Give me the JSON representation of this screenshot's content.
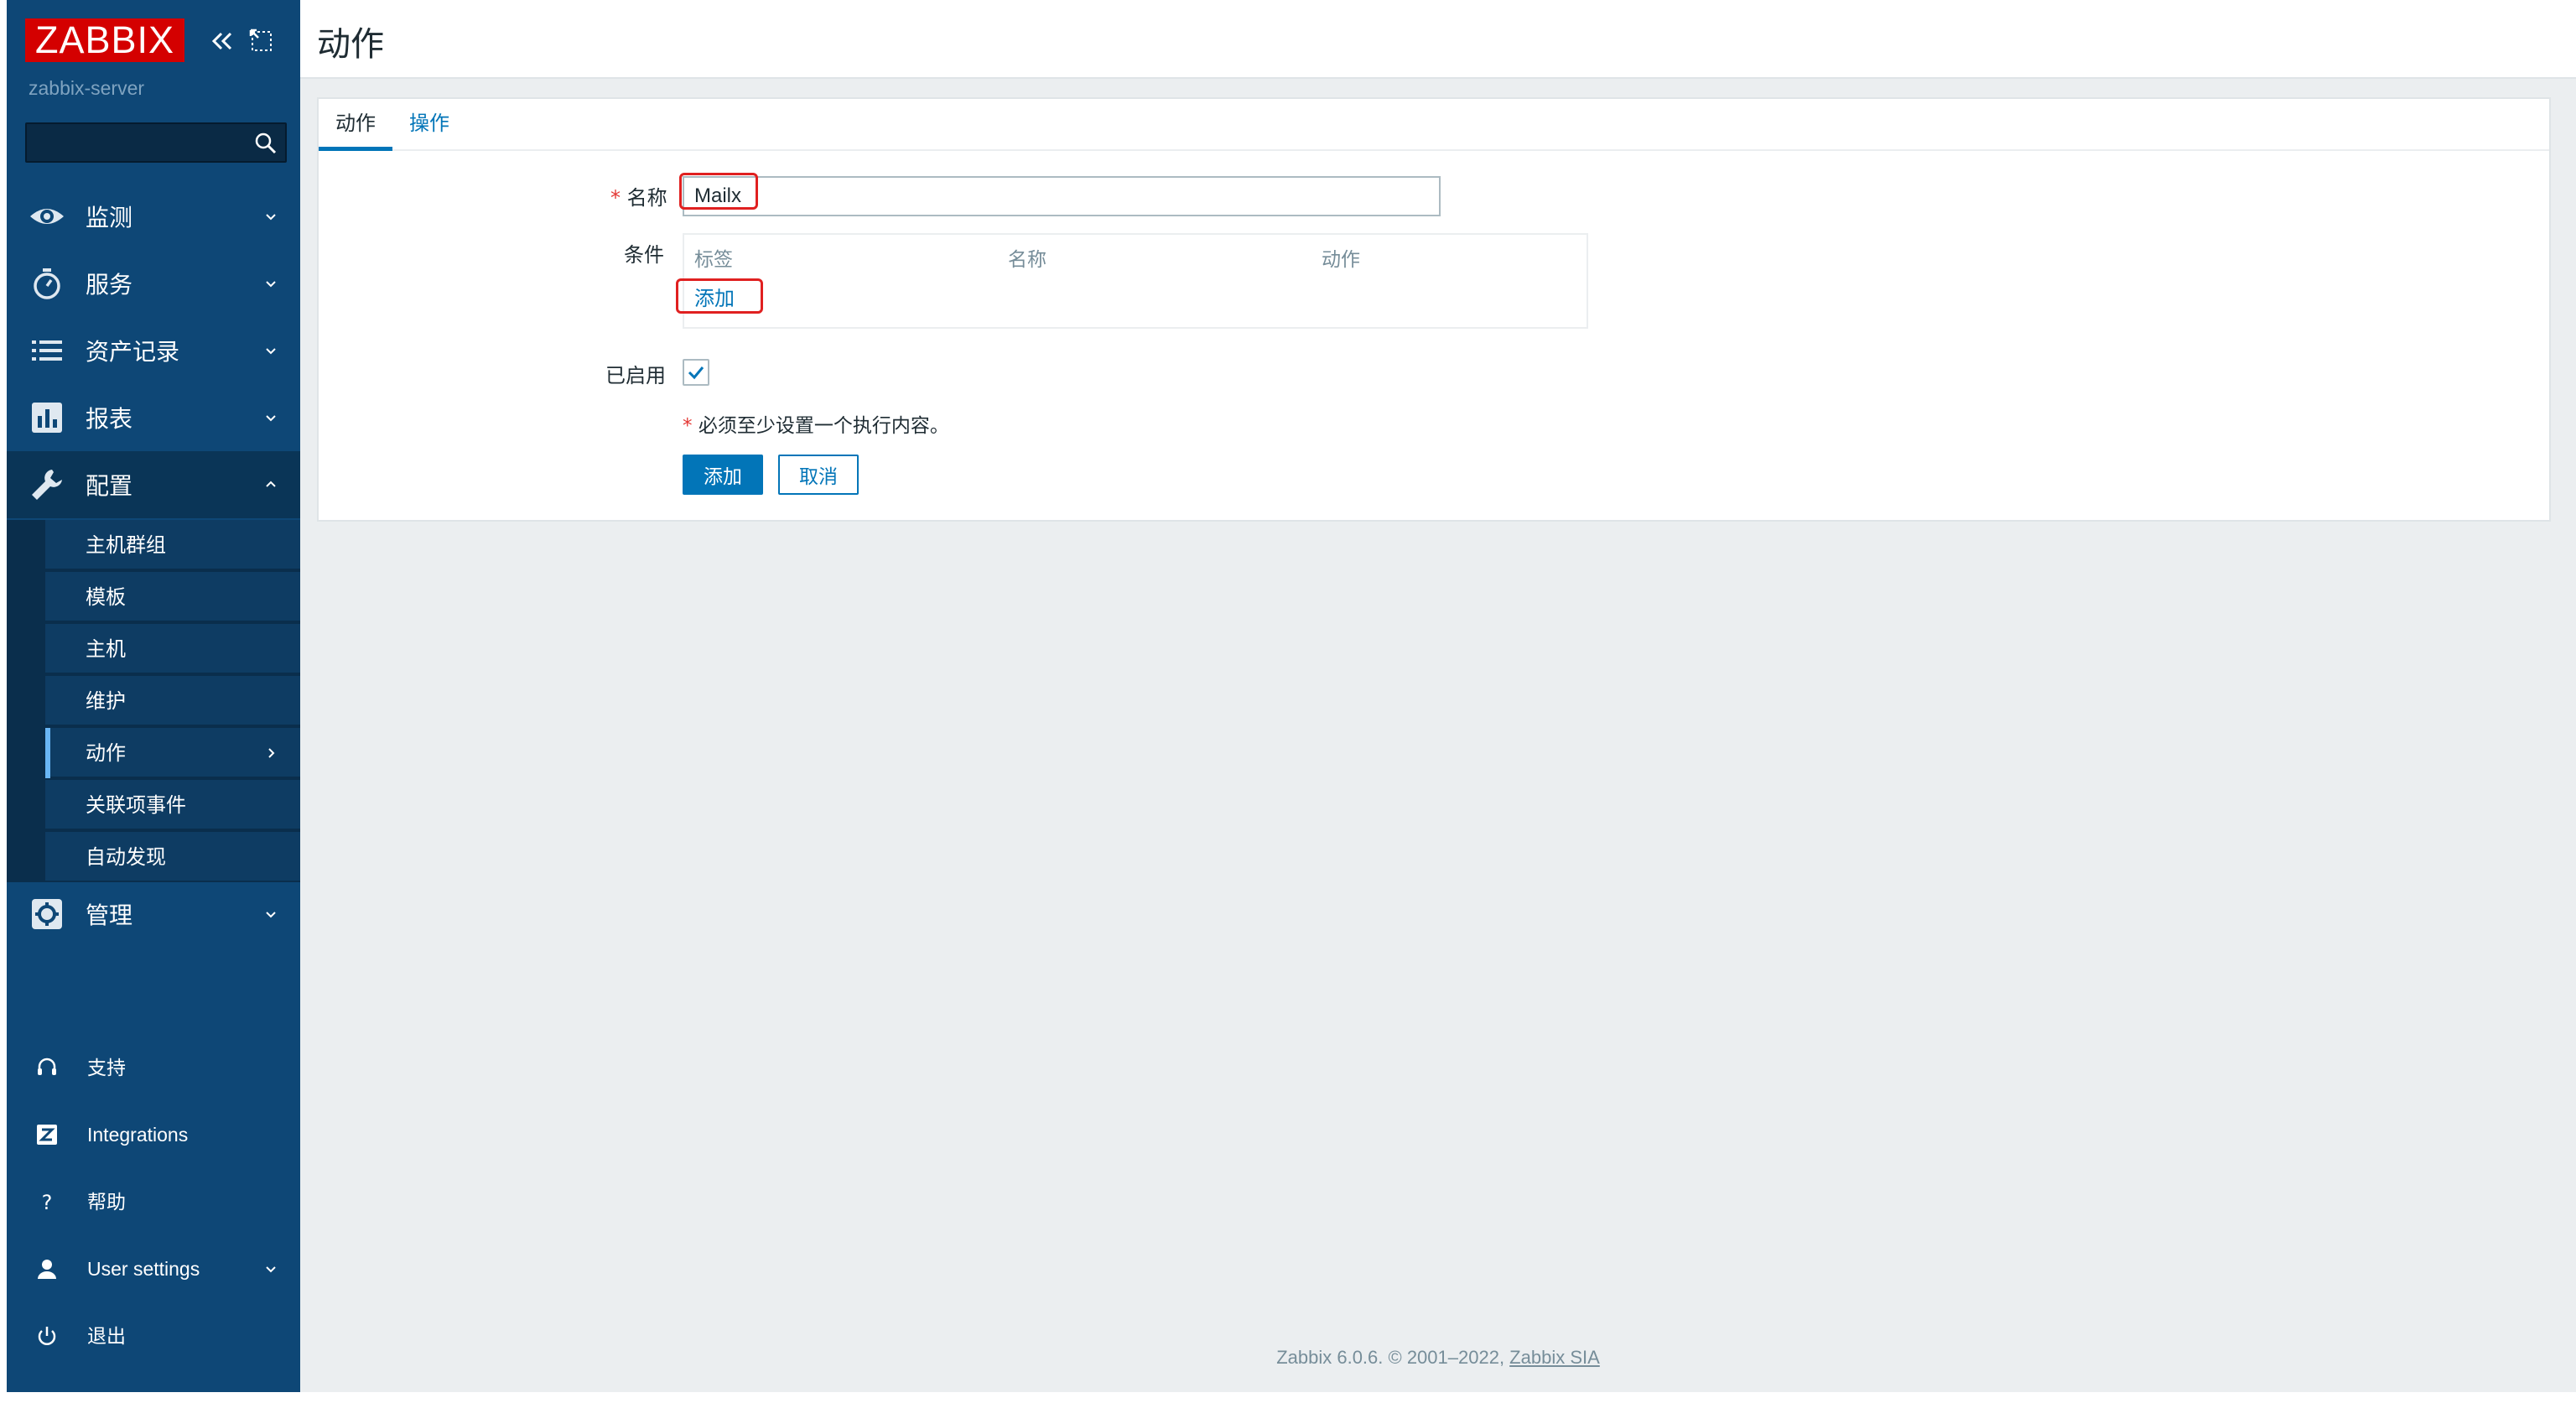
{
  "sidebar": {
    "logo": "ZABBIX",
    "server_name": "zabbix-server",
    "search": {
      "value": "",
      "placeholder": ""
    },
    "menu": [
      {
        "label": "监测",
        "icon": "eye-icon"
      },
      {
        "label": "服务",
        "icon": "stopwatch-icon"
      },
      {
        "label": "资产记录",
        "icon": "list-icon"
      },
      {
        "label": "报表",
        "icon": "bar-chart-icon"
      },
      {
        "label": "配置",
        "icon": "wrench-icon"
      },
      {
        "label": "管理",
        "icon": "gear-icon"
      }
    ],
    "config_submenu": [
      "主机群组",
      "模板",
      "主机",
      "维护",
      "动作",
      "关联项事件",
      "自动发现"
    ],
    "bottom": [
      {
        "label": "支持",
        "icon": "headset-icon"
      },
      {
        "label": "Integrations",
        "icon": "integrations-icon"
      },
      {
        "label": "帮助",
        "icon": "help-icon"
      },
      {
        "label": "User settings",
        "icon": "user-icon"
      },
      {
        "label": "退出",
        "icon": "power-icon"
      }
    ]
  },
  "header": {
    "title": "动作"
  },
  "tabs": [
    "动作",
    "操作"
  ],
  "form": {
    "name_label": "名称",
    "name_value": "Mailx",
    "conditions_label": "条件",
    "conditions_columns": [
      "标签",
      "名称",
      "动作"
    ],
    "add_condition": "添加",
    "enabled_label": "已启用",
    "enabled": true,
    "note": "必须至少设置一个执行内容。",
    "required_mark": "*"
  },
  "buttons": {
    "add": "添加",
    "cancel": "取消"
  },
  "footer": {
    "text": "Zabbix 6.0.6. © 2001–2022, ",
    "link": "Zabbix SIA"
  },
  "colors": {
    "sidebar": "#0e4776",
    "logo": "#d40000",
    "accent": "#0275b8",
    "highlight": "#e02020"
  }
}
